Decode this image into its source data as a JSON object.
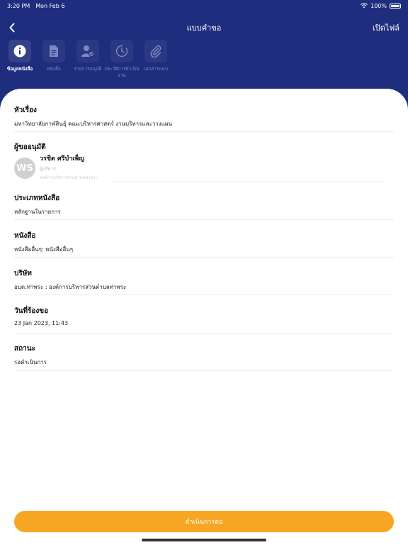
{
  "status_bar": {
    "time": "3:20 PM",
    "date": "Mon Feb 6",
    "battery": "100%"
  },
  "nav": {
    "title": "แบบคำขอ",
    "open_file": "เปิดไฟล์"
  },
  "tabs": [
    {
      "label": "ข้อมูลหนังสือ",
      "icon": "info-icon"
    },
    {
      "label": "หนังสือ",
      "icon": "document-icon"
    },
    {
      "label": "รายการอนุมัติ",
      "icon": "user-approve-icon"
    },
    {
      "label": "ประวัติการดำเนินงาน",
      "icon": "history-icon"
    },
    {
      "label": "เอกสารแนบ",
      "icon": "paperclip-icon"
    }
  ],
  "details": {
    "subject_label": "หัวเรื่อง",
    "subject_value": "มหาวิทยาลัยกาฬสินธุ์ คณะบริหารศาสตร์ งานบริหารและวางแผน",
    "approver_label": "ผู้ขออนุมัติ",
    "approver_initials": "WS",
    "approver_name": "วรชิต ศรีบำเพ็ญ",
    "approver_role": "ผู้บริหาร",
    "approver_dept": "องค์การบริหารส่วนตำบลท่าพระ",
    "doc_type_label": "ประเภทหนังสือ",
    "doc_type_value": "หลักฐานในรายการ",
    "document_label": "หนังสือ",
    "document_value": "หนังสืออื่นๆ: หนังสืออื่นๆ",
    "company_label": "บริษัท",
    "company_value": "อบต.ท่าพระ : องค์การบริหารส่วนตำบลท่าพระ",
    "request_date_label": "วันที่ร้องขอ",
    "request_date_value": "23 Jan 2023, 11:43",
    "status_label": "สถานะ",
    "status_value": "รอดำเนินการ"
  },
  "action": {
    "label": "ดำเนินการต่อ"
  },
  "colors": {
    "header": "#1e2d7d",
    "accent": "#f6a623"
  }
}
